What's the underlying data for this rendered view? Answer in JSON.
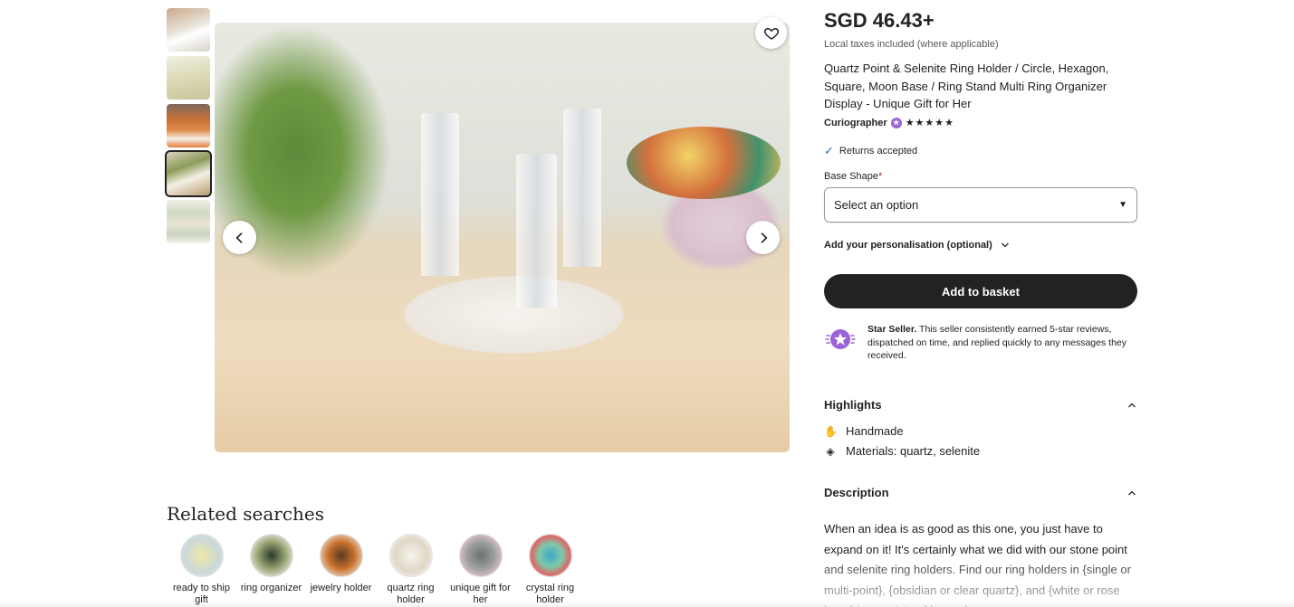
{
  "gallery": {
    "thumbnail_count": 5,
    "active_thumbnail": 4
  },
  "related": {
    "title": "Related searches",
    "items": [
      {
        "label": "ready to ship gift"
      },
      {
        "label": "ring organizer"
      },
      {
        "label": "jewelry holder"
      },
      {
        "label": "quartz ring holder"
      },
      {
        "label": "unique gift for her"
      },
      {
        "label": "crystal ring holder"
      }
    ]
  },
  "product": {
    "price": "SGD 46.43+",
    "tax_note": "Local taxes included (where applicable)",
    "title": "Quartz Point & Selenite Ring Holder / Circle, Hexagon, Square, Moon Base / Ring Stand Multi Ring Organizer Display - Unique Gift for Her",
    "seller": "Curiographer",
    "stars": "★★★★★",
    "rating": 5,
    "returns": "Returns accepted",
    "option_label": "Base Shape",
    "required_mark": "*",
    "select_placeholder": "Select an option",
    "personalisation": "Add your personalisation (optional)",
    "basket_button": "Add to basket"
  },
  "star_seller": {
    "heading": "Star Seller.",
    "text": " This seller consistently earned 5-star reviews, dispatched on time, and replied quickly to any messages they received."
  },
  "highlights": {
    "title": "Highlights",
    "items": [
      {
        "icon": "hand-icon",
        "label": "Handmade"
      },
      {
        "icon": "materials-icon",
        "label": "Materials: quartz, selenite"
      }
    ]
  },
  "description": {
    "title": "Description",
    "text": "When an idea is as good as this one, you just have to expand on it! It's certainly what we did with our stone point and selenite ring holders. Find our ring holders in {single or multi-point}, {obsidian or clear quartz}, and {white or rose base} in a variety of base shapes."
  },
  "colors": {
    "button_dark": "#222222",
    "star_seller_purple": "#9a63d6",
    "required_red": "#b3241c",
    "check_blue": "#2a6ebb"
  }
}
